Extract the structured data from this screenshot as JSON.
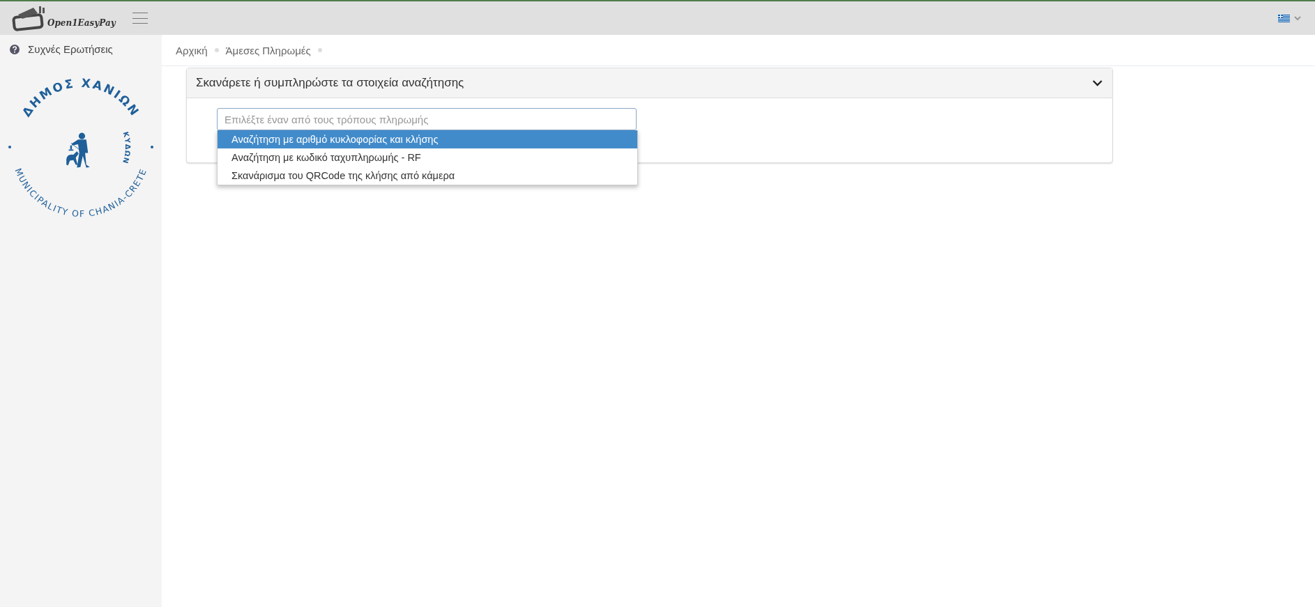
{
  "header": {
    "logo_text": "Open1EasyPay"
  },
  "sidebar": {
    "items": [
      {
        "label": "Συχνές Ερωτήσεις"
      }
    ],
    "seal": {
      "top_text": "ΔΗΜΟΣ ΧΑΝΙΩΝ",
      "inner_text": "ΚΥΔΩΝ",
      "bottom_text": "MUNICIPALITY OF CHANIA-CRETE"
    }
  },
  "breadcrumb": [
    "Αρχική",
    "Άμεσες Πληρωμές"
  ],
  "panel": {
    "title": "Σκανάρετε ή συμπληρώστε τα στοιχεία αναζήτησης",
    "expanded": true,
    "select": {
      "placeholder": "Επιλέξτε έναν από τους τρόπους πληρωμής",
      "options": [
        {
          "label": "Αναζήτηση με αριθμό κυκλοφορίας και κλήσης",
          "selected": true
        },
        {
          "label": "Αναζήτηση με κωδικό ταχυπληρωμής - RF",
          "selected": false
        },
        {
          "label": "Σκανάρισμα του QRCode της κλήσης από κάμερα",
          "selected": false
        }
      ]
    }
  }
}
